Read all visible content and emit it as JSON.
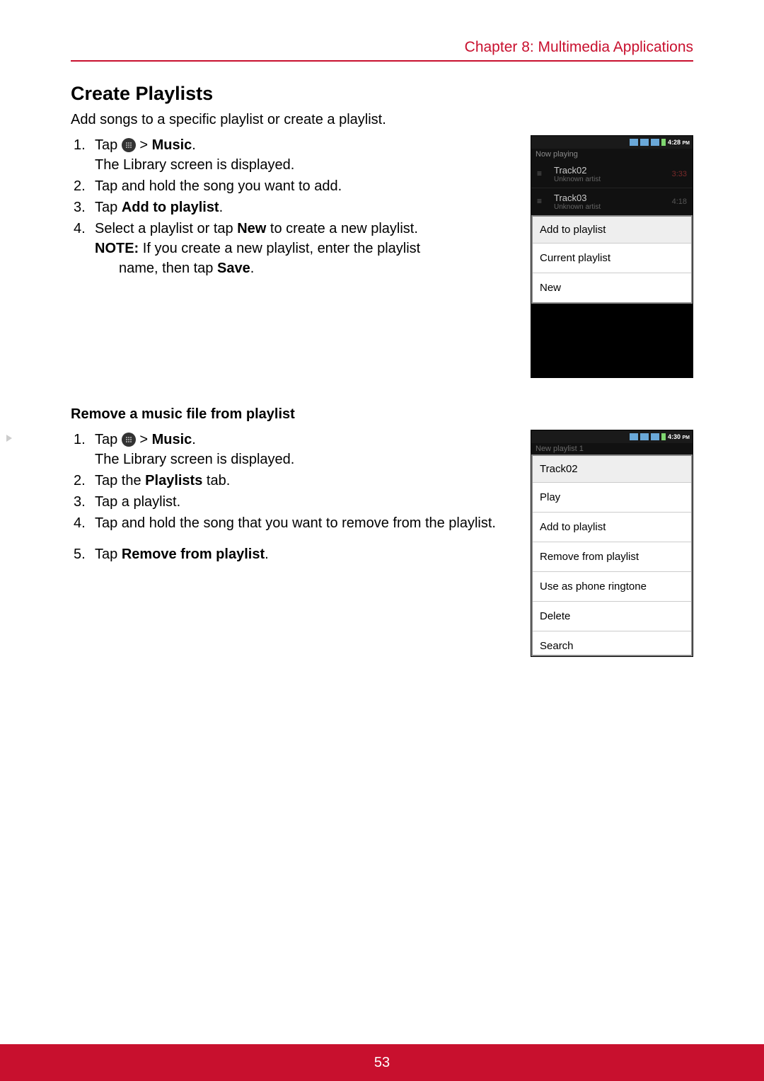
{
  "header": {
    "chapter": "Chapter 8: Multimedia Applications"
  },
  "section1": {
    "title": "Create Playlists",
    "intro": "Add songs to a specific playlist or create a playlist.",
    "steps": {
      "s1_pre": "Tap ",
      "s1_sep": "  > ",
      "s1_bold": "Music",
      "s1_post": ".",
      "s1_sub": "The Library screen is displayed.",
      "s2": "Tap and hold the song you want to add.",
      "s3_pre": "Tap ",
      "s3_bold": "Add to playlist",
      "s3_post": ".",
      "s4_pre": "Select a playlist or tap ",
      "s4_bold": "New",
      "s4_post": " to create a new playlist.",
      "note_label": "NOTE:",
      "note_body1": " If you create a new playlist, enter the playlist",
      "note_body2": "name, then tap ",
      "note_bold": "Save",
      "note_post": "."
    }
  },
  "phone1": {
    "time": "4:28",
    "ampm": "PM",
    "now_playing": "Now playing",
    "tracks": [
      {
        "title": "Track02",
        "artist": "Unknown artist",
        "dur": "3:33"
      },
      {
        "title": "Track03",
        "artist": "Unknown artist",
        "dur": "4:18"
      }
    ],
    "menu_header": "Add to playlist",
    "menu_items": [
      "Current playlist",
      "New"
    ]
  },
  "section2": {
    "heading": "Remove a music file from playlist",
    "steps": {
      "s1_pre": "Tap ",
      "s1_sep": "  > ",
      "s1_bold": "Music",
      "s1_post": ".",
      "s1_sub": "The Library screen is displayed.",
      "s2_pre": "Tap the ",
      "s2_bold": "Playlists",
      "s2_post": " tab.",
      "s3": "Tap a playlist.",
      "s4": "Tap and hold the song that you want to remove from the playlist.",
      "s5_pre": "Tap ",
      "s5_bold": "Remove from playlist",
      "s5_post": "."
    }
  },
  "phone2": {
    "time": "4:30",
    "ampm": "PM",
    "playlist_name": "New playlist 1",
    "menu_header": "Track02",
    "menu_items": [
      "Play",
      "Add to playlist",
      "Remove from playlist",
      "Use as phone ringtone",
      "Delete",
      "Search"
    ]
  },
  "footer": {
    "page": "53"
  }
}
